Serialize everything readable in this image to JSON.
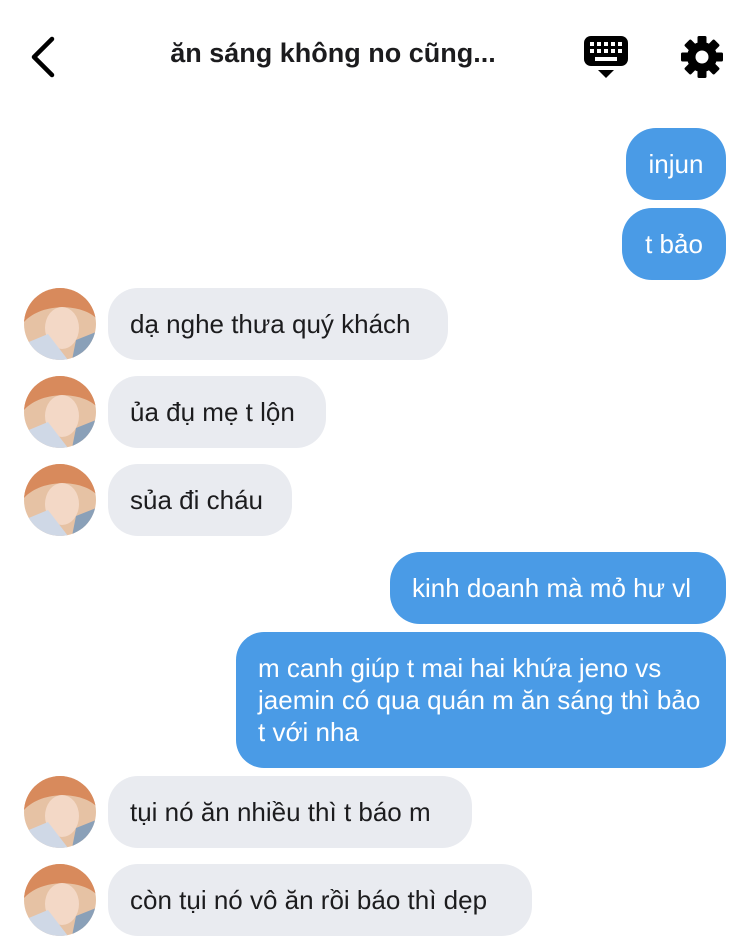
{
  "header": {
    "title": "ăn sáng không no cũng..."
  },
  "messages": [
    {
      "side": "out",
      "text": "injun"
    },
    {
      "side": "out",
      "text": "t bảo"
    },
    {
      "side": "in",
      "text": "dạ nghe thưa quý khách"
    },
    {
      "side": "in",
      "text": "ủa đụ mẹ t lộn"
    },
    {
      "side": "in",
      "text": "sủa đi cháu"
    },
    {
      "side": "out",
      "text": "kinh doanh mà mỏ hư vl"
    },
    {
      "side": "out",
      "text": "m canh giúp t mai hai khứa jeno vs jaemin có qua quán m ăn sáng thì bảo t với nha"
    },
    {
      "side": "in",
      "text": "tụi nó ăn nhiều thì t báo m"
    },
    {
      "side": "in",
      "text": "còn tụi nó vô ăn rồi báo thì dẹp"
    }
  ],
  "colors": {
    "outgoing_bubble": "#4a9be6",
    "incoming_bubble": "#e9ebf0"
  },
  "icons": {
    "back": "chevron-left-icon",
    "keyboard": "keyboard-icon",
    "settings": "gear-icon",
    "avatar": "avatar-photo"
  }
}
